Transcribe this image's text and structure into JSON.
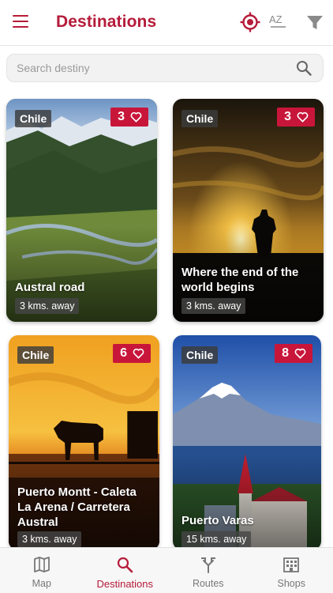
{
  "header": {
    "title": "Destinations",
    "icons": [
      "menu-icon",
      "location-target-icon",
      "sort-az-icon",
      "filter-icon"
    ],
    "sort_label": "AZ"
  },
  "search": {
    "placeholder": "Search destiny"
  },
  "cards": [
    {
      "country": "Chile",
      "likes": "3",
      "title": "Austral road",
      "distance": "3 kms. away"
    },
    {
      "country": "Chile",
      "likes": "3",
      "title": "Where the end of the world begins",
      "distance": "3 kms. away"
    },
    {
      "country": "Chile",
      "likes": "6",
      "title": "Puerto Montt - Caleta La Arena / Carretera Austral",
      "distance": "3 kms. away"
    },
    {
      "country": "Chile",
      "likes": "8",
      "title": "Puerto Varas",
      "distance": "15 kms. away"
    }
  ],
  "nav": {
    "items": [
      {
        "label": "Map",
        "icon": "map-icon",
        "active": false
      },
      {
        "label": "Destinations",
        "icon": "search-icon",
        "active": true
      },
      {
        "label": "Routes",
        "icon": "routes-icon",
        "active": false
      },
      {
        "label": "Shops",
        "icon": "shops-icon",
        "active": false
      }
    ]
  },
  "colors": {
    "accent": "#b51b3a",
    "badge": "#c8163a"
  }
}
